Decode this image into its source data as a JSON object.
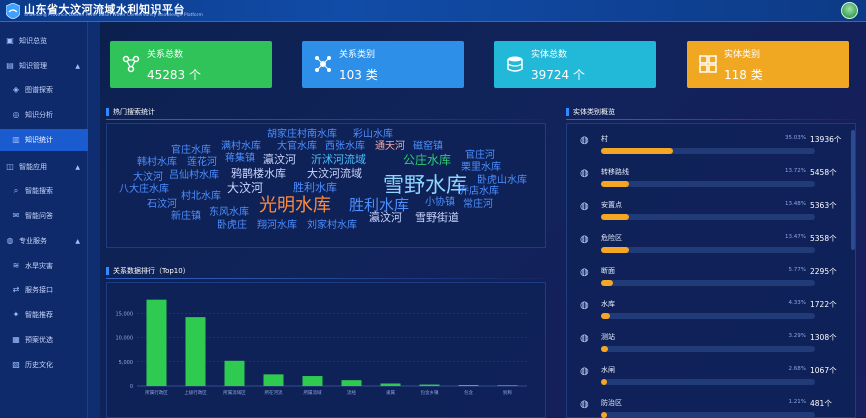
{
  "header": {
    "title": "山东省大汶河流域水利知识平台",
    "subtitle": "Shandong Province Dawen River Basin Water Conservancy Knowledge Platform",
    "avatar_icon": "user-avatar-icon"
  },
  "sidebar": {
    "items": [
      {
        "label": "知识总览",
        "icon": "home-icon",
        "level": 0,
        "active": false
      },
      {
        "label": "知识管理",
        "icon": "folder-icon",
        "level": 0,
        "active": false,
        "caret": "▲"
      },
      {
        "label": "图谱探索",
        "icon": "graph-icon",
        "level": 1,
        "active": false
      },
      {
        "label": "知识分析",
        "icon": "analysis-icon",
        "level": 1,
        "active": false
      },
      {
        "label": "知识统计",
        "icon": "stats-icon",
        "level": 1,
        "active": true
      },
      {
        "label": "智能应用",
        "icon": "app-icon",
        "level": 0,
        "active": false,
        "caret": "▲"
      },
      {
        "label": "智能搜索",
        "icon": "search-icon",
        "level": 1,
        "active": false
      },
      {
        "label": "智能问答",
        "icon": "qa-icon",
        "level": 1,
        "active": false
      },
      {
        "label": "专业服务",
        "icon": "service-icon",
        "level": 0,
        "active": false,
        "caret": "▲"
      },
      {
        "label": "水旱灾害",
        "icon": "water-icon",
        "level": 1,
        "active": false
      },
      {
        "label": "服务接口",
        "icon": "api-icon",
        "level": 1,
        "active": false
      },
      {
        "label": "智能推荐",
        "icon": "recommend-icon",
        "level": 1,
        "active": false
      },
      {
        "label": "预案优选",
        "icon": "plan-icon",
        "level": 1,
        "active": false
      },
      {
        "label": "历史文化",
        "icon": "culture-icon",
        "level": 1,
        "active": false
      }
    ]
  },
  "cards": [
    {
      "label": "关系总数",
      "value": "45283 个",
      "icon": "relation-total-icon",
      "color": "#2fc35a"
    },
    {
      "label": "关系类别",
      "value": "103 类",
      "icon": "relation-type-icon",
      "color": "#2d8fe8"
    },
    {
      "label": "实体总数",
      "value": "39724 个",
      "icon": "entity-total-icon",
      "color": "#22b8d8"
    },
    {
      "label": "实体类别",
      "value": "118 类",
      "icon": "entity-type-icon",
      "color": "#f0a823"
    }
  ],
  "hot_search": {
    "title": "热门搜索统计",
    "words": [
      {
        "text": "胡家庄村南水库",
        "color": "#4d8fff",
        "size": 10
      },
      {
        "text": "彩山水库",
        "color": "#4d8fff",
        "size": 10
      },
      {
        "text": "官庄水库",
        "color": "#4d8fff",
        "size": 10
      },
      {
        "text": "满村水库",
        "color": "#4d8fff",
        "size": 10
      },
      {
        "text": "大官水库",
        "color": "#4d8fff",
        "size": 10
      },
      {
        "text": "西张水库",
        "color": "#4d8fff",
        "size": 10
      },
      {
        "text": "通天河",
        "color": "#f0a9a9",
        "size": 10
      },
      {
        "text": "磁窑镇",
        "color": "#4d8fff",
        "size": 10
      },
      {
        "text": "官庄河",
        "color": "#4d8fff",
        "size": 10
      },
      {
        "text": "韩村水库",
        "color": "#4d8fff",
        "size": 10
      },
      {
        "text": "莲花河",
        "color": "#4d8fff",
        "size": 10
      },
      {
        "text": "蒋集镇",
        "color": "#4d8fff",
        "size": 10
      },
      {
        "text": "瀛汶河",
        "color": "#c9d6ff",
        "size": 11
      },
      {
        "text": "沂沭河流域",
        "color": "#4dc0ff",
        "size": 11
      },
      {
        "text": "公庄水库",
        "color": "#2ecb71",
        "size": 12
      },
      {
        "text": "栗里水库",
        "color": "#4d8fff",
        "size": 10
      },
      {
        "text": "大汶河",
        "color": "#4d8fff",
        "size": 10
      },
      {
        "text": "吕仙村水库",
        "color": "#4d8fff",
        "size": 10
      },
      {
        "text": "鸦鹊楼水库",
        "color": "#c9d6ff",
        "size": 11
      },
      {
        "text": "大汶河流域",
        "color": "#c9d6ff",
        "size": 11
      },
      {
        "text": "卧虎山水库",
        "color": "#4d8fff",
        "size": 10
      },
      {
        "text": "八大庄水库",
        "color": "#4d8fff",
        "size": 10
      },
      {
        "text": "大汶河",
        "color": "#c9d6ff",
        "size": 12
      },
      {
        "text": "胜利水库",
        "color": "#4d8fff",
        "size": 11
      },
      {
        "text": "雪野水库",
        "color": "#8fd6ff",
        "size": 21
      },
      {
        "text": "乔店水库",
        "color": "#4d8fff",
        "size": 10
      },
      {
        "text": "村北水库",
        "color": "#4d8fff",
        "size": 10
      },
      {
        "text": "石汶河",
        "color": "#4d8fff",
        "size": 10
      },
      {
        "text": "光明水库",
        "color": "#ff8a3d",
        "size": 18
      },
      {
        "text": "胜利水库",
        "color": "#4d8fff",
        "size": 15
      },
      {
        "text": "小协镇",
        "color": "#4d8fff",
        "size": 10
      },
      {
        "text": "常庄河",
        "color": "#4d8fff",
        "size": 10
      },
      {
        "text": "东风水库",
        "color": "#4d8fff",
        "size": 10
      },
      {
        "text": "新庄镇",
        "color": "#4d8fff",
        "size": 10
      },
      {
        "text": "瀛汶河",
        "color": "#c9d6ff",
        "size": 11
      },
      {
        "text": "雪野街道",
        "color": "#c9d6ff",
        "size": 11
      },
      {
        "text": "卧虎庄",
        "color": "#4d8fff",
        "size": 10
      },
      {
        "text": "翔河水库",
        "color": "#4d8fff",
        "size": 10
      },
      {
        "text": "刘家村水库",
        "color": "#4d8fff",
        "size": 10
      }
    ]
  },
  "relation_rank": {
    "title": "关系数据排行（Top10）"
  },
  "chart_data": {
    "type": "bar",
    "title": "关系数据排行（Top10）",
    "categories": [
      "所属行政区",
      "上级行政区",
      "所属流域区",
      "所在河流",
      "所属流域",
      "流经",
      "隶属",
      "包含乡镇",
      "包含",
      "别称"
    ],
    "values": [
      17800,
      14200,
      5200,
      2400,
      2050,
      1200,
      520,
      300,
      200,
      150
    ],
    "ylim": [
      0,
      20000
    ],
    "yticks": [
      "0",
      "5,000",
      "10,000",
      "15,000"
    ],
    "ytick_values": [
      0,
      5000,
      10000,
      15000
    ],
    "grid": true,
    "bar_color": "#2ecb50"
  },
  "entity_types": {
    "title": "实体类别概览",
    "rows": [
      {
        "name": "村",
        "pct": "35.03%",
        "value": "13936个",
        "fraction": 0.3503
      },
      {
        "name": "转移路线",
        "pct": "13.72%",
        "value": "5458个",
        "fraction": 0.1372
      },
      {
        "name": "安置点",
        "pct": "13.48%",
        "value": "5363个",
        "fraction": 0.1348
      },
      {
        "name": "危险区",
        "pct": "13.47%",
        "value": "5358个",
        "fraction": 0.1347
      },
      {
        "name": "断面",
        "pct": "5.77%",
        "value": "2295个",
        "fraction": 0.0577
      },
      {
        "name": "水库",
        "pct": "4.33%",
        "value": "1722个",
        "fraction": 0.0433
      },
      {
        "name": "测站",
        "pct": "3.29%",
        "value": "1308个",
        "fraction": 0.0329
      },
      {
        "name": "水闸",
        "pct": "2.68%",
        "value": "1067个",
        "fraction": 0.0268
      },
      {
        "name": "防治区",
        "pct": "1.21%",
        "value": "481个",
        "fraction": 0.0121
      }
    ],
    "row_icon": "entity-type-row-icon"
  },
  "colors": {
    "accent": "#2f8bff",
    "active_nav": "#1a5bd0",
    "progress": "#f5a623"
  }
}
